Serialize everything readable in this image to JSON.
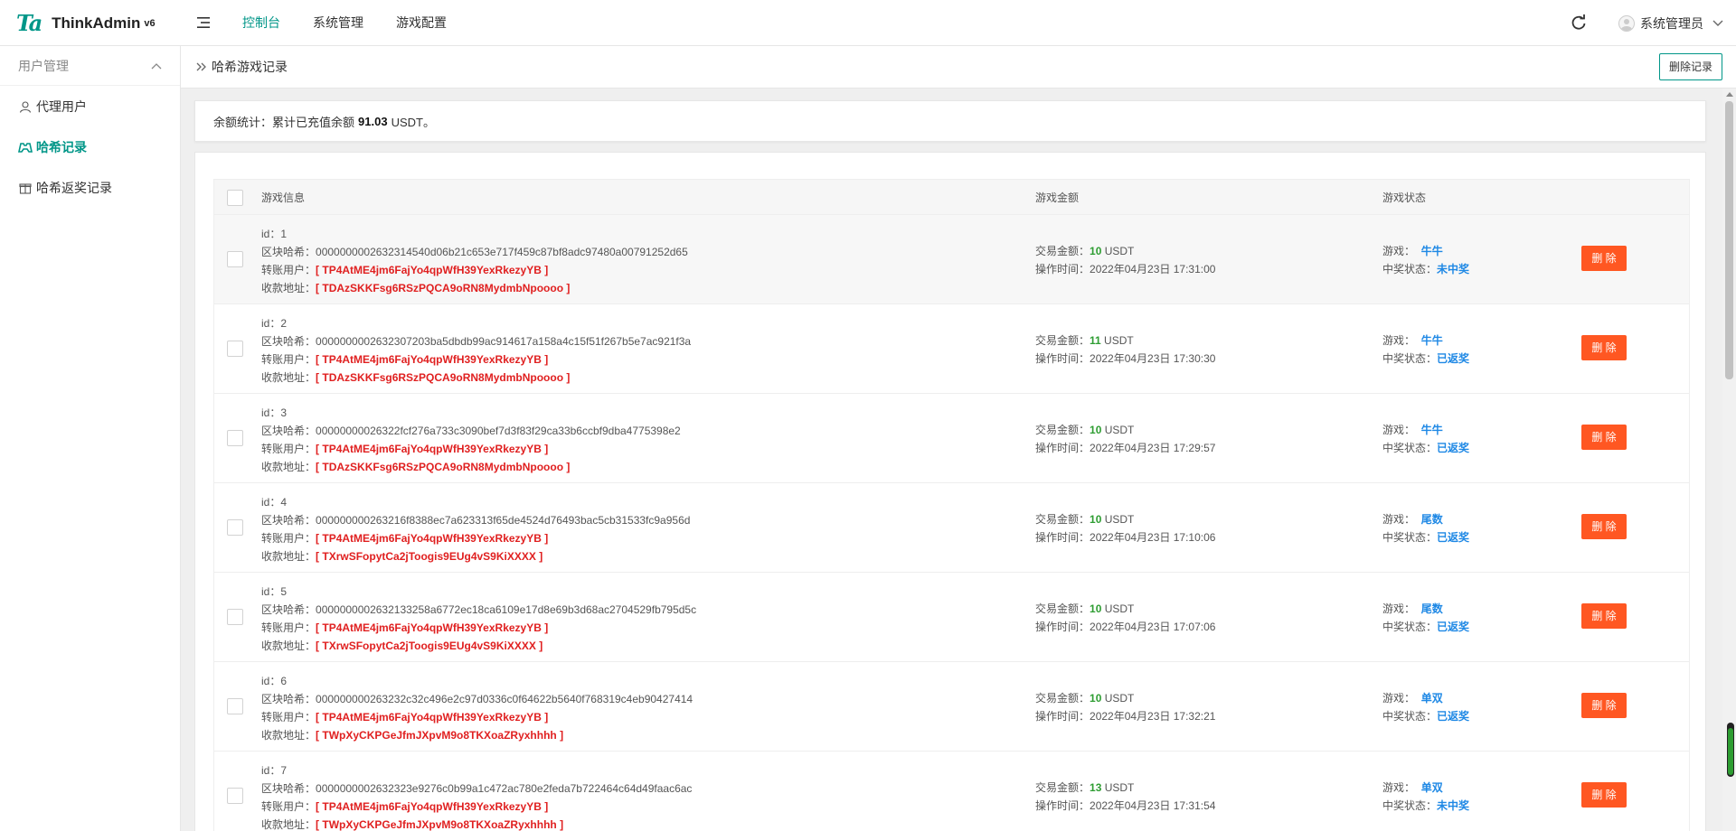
{
  "header": {
    "logo_mark": "Ta",
    "app_name": "ThinkAdmin",
    "version": "v6",
    "nav": [
      {
        "label": "控制台",
        "active": true
      },
      {
        "label": "系统管理",
        "active": false
      },
      {
        "label": "游戏配置",
        "active": false
      }
    ],
    "user_name": "系统管理员"
  },
  "sidebar": {
    "group_label": "用户管理",
    "items": [
      {
        "label": "代理用户",
        "icon": "user-icon",
        "active": false
      },
      {
        "label": "哈希记录",
        "icon": "gamepad-icon",
        "active": true
      },
      {
        "label": "哈希返奖记录",
        "icon": "gift-icon",
        "active": false
      }
    ]
  },
  "breadcrumb": {
    "title": "哈希游戏记录",
    "delete_button": "删除记录"
  },
  "stats": {
    "prefix": "余额统计：累计已充值余额",
    "amount": "91.03",
    "suffix": "USDT。"
  },
  "table": {
    "headers": {
      "info": "游戏信息",
      "amount": "游戏金额",
      "status": "游戏状态"
    },
    "labels": {
      "id": "id：",
      "hash": "区块哈希：",
      "from": "转账用户：",
      "to": "收款地址：",
      "amount": "交易金额：",
      "unit": "USDT",
      "time": "操作时间：",
      "game": "游戏：",
      "prize": "中奖状态：",
      "delete": "删 除"
    },
    "rows": [
      {
        "id": "1",
        "hash": "0000000002632314540d06b21c653e717f459c87bf8adc97480a00791252d65",
        "from": "TP4AtME4jm6FajYo4qpWfH39YexRkezyYB",
        "to": "TDAzSKKFsg6RSzPQCA9oRN8MydmbNpoooo",
        "amount": "10",
        "time": "2022年04月23日 17:31:00",
        "game": "牛牛",
        "prize": "未中奖"
      },
      {
        "id": "2",
        "hash": "0000000002632307203ba5dbdb99ac914617a158a4c15f51f267b5e7ac921f3a",
        "from": "TP4AtME4jm6FajYo4qpWfH39YexRkezyYB",
        "to": "TDAzSKKFsg6RSzPQCA9oRN8MydmbNpoooo",
        "amount": "11",
        "time": "2022年04月23日 17:30:30",
        "game": "牛牛",
        "prize": "已返奖"
      },
      {
        "id": "3",
        "hash": "00000000026322fcf276a733c3090bef7d3f83f29ca33b6ccbf9dba4775398e2",
        "from": "TP4AtME4jm6FajYo4qpWfH39YexRkezyYB",
        "to": "TDAzSKKFsg6RSzPQCA9oRN8MydmbNpoooo",
        "amount": "10",
        "time": "2022年04月23日 17:29:57",
        "game": "牛牛",
        "prize": "已返奖"
      },
      {
        "id": "4",
        "hash": "000000000263216f8388ec7a623313f65de4524d76493bac5cb31533fc9a956d",
        "from": "TP4AtME4jm6FajYo4qpWfH39YexRkezyYB",
        "to": "TXrwSFopytCa2jToogis9EUg4vS9KiXXXX",
        "amount": "10",
        "time": "2022年04月23日 17:10:06",
        "game": "尾数",
        "prize": "已返奖"
      },
      {
        "id": "5",
        "hash": "0000000002632133258a6772ec18ca6109e17d8e69b3d68ac2704529fb795d5c",
        "from": "TP4AtME4jm6FajYo4qpWfH39YexRkezyYB",
        "to": "TXrwSFopytCa2jToogis9EUg4vS9KiXXXX",
        "amount": "10",
        "time": "2022年04月23日 17:07:06",
        "game": "尾数",
        "prize": "已返奖"
      },
      {
        "id": "6",
        "hash": "000000000263232c32c496e2c97d0336c0f64622b5640f768319c4eb90427414",
        "from": "TP4AtME4jm6FajYo4qpWfH39YexRkezyYB",
        "to": "TWpXyCKPGeJfmJXpvM9o8TKXoaZRyxhhhh",
        "amount": "10",
        "time": "2022年04月23日 17:32:21",
        "game": "单双",
        "prize": "已返奖"
      },
      {
        "id": "7",
        "hash": "0000000002632323e9276c0b99a1c472ac780e2feda7b722464c64d49faac6ac",
        "from": "TP4AtME4jm6FajYo4qpWfH39YexRkezyYB",
        "to": "TWpXyCKPGeJfmJXpvM9o8TKXoaZRyxhhhh",
        "amount": "13",
        "time": "2022年04月23日 17:31:54",
        "game": "单双",
        "prize": "未中奖"
      }
    ]
  },
  "colors": {
    "brand": "#009688",
    "danger": "#ff5722",
    "address_red": "#e02020",
    "amount_green": "#2e9d32",
    "status_blue": "#1e88e5"
  }
}
